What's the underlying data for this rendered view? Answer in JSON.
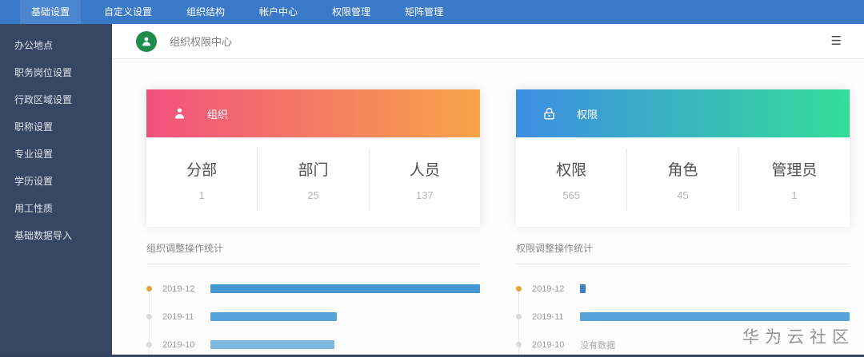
{
  "navbar": {
    "tabs": [
      {
        "label": "基础设置",
        "active": true
      },
      {
        "label": "自定义设置",
        "active": false
      },
      {
        "label": "组织结构",
        "active": false
      },
      {
        "label": "帐户中心",
        "active": false
      },
      {
        "label": "权限管理",
        "active": false
      },
      {
        "label": "矩阵管理",
        "active": false
      }
    ]
  },
  "sidebar": {
    "items": [
      {
        "label": "办公地点"
      },
      {
        "label": "职务岗位设置"
      },
      {
        "label": "行政区域设置"
      },
      {
        "label": "职称设置"
      },
      {
        "label": "专业设置"
      },
      {
        "label": "学历设置"
      },
      {
        "label": "用工性质"
      },
      {
        "label": "基础数据导入"
      }
    ]
  },
  "header": {
    "title": "组织权限中心",
    "icon": "org-person-icon",
    "menu_icon": "list-icon"
  },
  "cards": [
    {
      "title": "组织",
      "icon": "person-icon",
      "gradient_start": "#f1517e",
      "gradient_end": "#f7a44a",
      "stats": [
        {
          "label": "分部",
          "value": "1"
        },
        {
          "label": "部门",
          "value": "25"
        },
        {
          "label": "人员",
          "value": "137"
        }
      ]
    },
    {
      "title": "权限",
      "icon": "lock-icon",
      "gradient_start": "#3e8de2",
      "gradient_end": "#35dd99",
      "stats": [
        {
          "label": "权限",
          "value": "565"
        },
        {
          "label": "角色",
          "value": "45"
        },
        {
          "label": "管理员",
          "value": "1"
        }
      ]
    }
  ],
  "chart_data": [
    {
      "type": "bar",
      "orientation": "horizontal",
      "title": "组织调整操作统计",
      "categories": [
        "2019-12",
        "2019-11",
        "2019-10"
      ],
      "values_pct_of_max": [
        100,
        47,
        46
      ],
      "bar_colors": [
        "#4696d2",
        "#55a3d8",
        "#7cb8df"
      ],
      "axis_labels_visible": false,
      "grid": false,
      "legend": "none"
    },
    {
      "type": "bar",
      "orientation": "horizontal",
      "title": "权限调整操作统计",
      "categories": [
        "2019-12",
        "2019-11",
        "2019-10"
      ],
      "values_pct_of_max": [
        2,
        100,
        null
      ],
      "bar_colors": [
        "#3c80c5",
        "#55a3d8",
        null
      ],
      "no_data_label": "没有数据",
      "axis_labels_visible": false,
      "grid": false,
      "legend": "none"
    }
  ],
  "watermark": "华为云社区",
  "colors": {
    "navbar": "#3a78c8",
    "navbar_active_tab": "#4d86d0",
    "sidebar": "#374763",
    "header_icon_bg": "#1f8e4d",
    "timeline_dot_active": "#e8a33d",
    "timeline_dot_inactive": "#d9d9d9"
  }
}
